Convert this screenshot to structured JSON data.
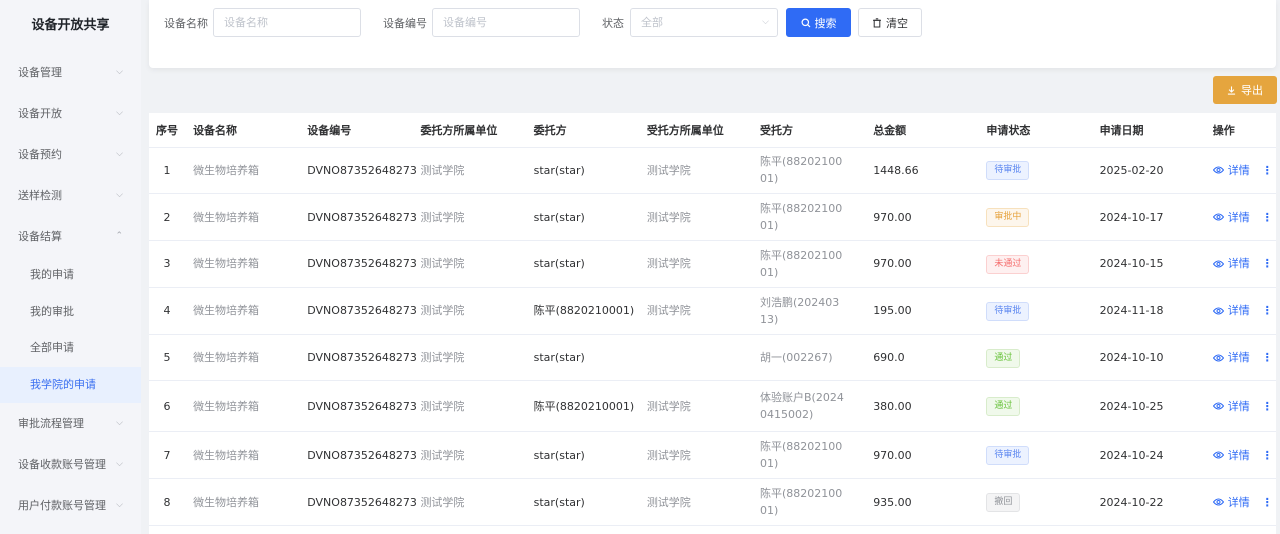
{
  "sidebar": {
    "title": "设备开放共享",
    "items": [
      {
        "label": "设备管理",
        "chevron": "⌵"
      },
      {
        "label": "设备开放",
        "chevron": "⌵"
      },
      {
        "label": "设备预约",
        "chevron": "⌵"
      },
      {
        "label": "送样检测",
        "chevron": "⌵"
      },
      {
        "label": "设备结算",
        "chevron": "⌃"
      }
    ],
    "subitems": [
      {
        "label": "我的申请"
      },
      {
        "label": "我的审批"
      },
      {
        "label": "全部申请"
      },
      {
        "label": "我学院的申请"
      }
    ],
    "items_after": [
      {
        "label": "审批流程管理",
        "chevron": "⌵"
      },
      {
        "label": "设备收款账号管理",
        "chevron": "⌵"
      },
      {
        "label": "用户付款账号管理",
        "chevron": "⌵"
      }
    ]
  },
  "search": {
    "device_name_label": "设备名称",
    "device_name_placeholder": "设备名称",
    "device_code_label": "设备编号",
    "device_code_placeholder": "设备编号",
    "status_label": "状态",
    "status_value": "全部",
    "search_button": "搜索",
    "clear_button": "清空"
  },
  "toolbar": {
    "export_button": "导出"
  },
  "table": {
    "columns": [
      "序号",
      "设备名称",
      "设备编号",
      "委托方所属单位",
      "委托方",
      "受托方所属单位",
      "受托方",
      "总金额",
      "申请状态",
      "申请日期",
      "操作"
    ],
    "detail_label": "详情",
    "rows": [
      {
        "no": "1",
        "device": "微生物培养箱",
        "code": "DVNO87352648273",
        "client_unit": "测试学院",
        "client": "star(star)",
        "trustee_unit": "测试学院",
        "trustee": "陈平(8820210001)",
        "amount": "1448.66",
        "status": "待审批",
        "status_color": "blue",
        "date": "2025-02-20"
      },
      {
        "no": "2",
        "device": "微生物培养箱",
        "code": "DVNO87352648273",
        "client_unit": "测试学院",
        "client": "star(star)",
        "trustee_unit": "测试学院",
        "trustee": "陈平(8820210001)",
        "amount": "970.00",
        "status": "审批中",
        "status_color": "orange",
        "date": "2024-10-17"
      },
      {
        "no": "3",
        "device": "微生物培养箱",
        "code": "DVNO87352648273",
        "client_unit": "测试学院",
        "client": "star(star)",
        "trustee_unit": "测试学院",
        "trustee": "陈平(8820210001)",
        "amount": "970.00",
        "status": "未通过",
        "status_color": "red",
        "date": "2024-10-15"
      },
      {
        "no": "4",
        "device": "微生物培养箱",
        "code": "DVNO87352648273",
        "client_unit": "测试学院",
        "client": "陈平(8820210001)",
        "trustee_unit": "测试学院",
        "trustee": "刘浩鹏(20240313)",
        "amount": "195.00",
        "status": "待审批",
        "status_color": "blue",
        "date": "2024-11-18"
      },
      {
        "no": "5",
        "device": "微生物培养箱",
        "code": "DVNO87352648273",
        "client_unit": "测试学院",
        "client": "star(star)",
        "trustee_unit": "",
        "trustee": "胡一(002267)",
        "amount": "690.0",
        "status": "通过",
        "status_color": "green",
        "date": "2024-10-10"
      },
      {
        "no": "6",
        "device": "微生物培养箱",
        "code": "DVNO87352648273",
        "client_unit": "测试学院",
        "client": "陈平(8820210001)",
        "trustee_unit": "测试学院",
        "trustee": "体验账户B(20240415002)",
        "amount": "380.00",
        "status": "通过",
        "status_color": "green",
        "date": "2024-10-25"
      },
      {
        "no": "7",
        "device": "微生物培养箱",
        "code": "DVNO87352648273",
        "client_unit": "测试学院",
        "client": "star(star)",
        "trustee_unit": "测试学院",
        "trustee": "陈平(8820210001)",
        "amount": "970.00",
        "status": "待审批",
        "status_color": "blue",
        "date": "2024-10-24"
      },
      {
        "no": "8",
        "device": "微生物培养箱",
        "code": "DVNO87352648273",
        "client_unit": "测试学院",
        "client": "star(star)",
        "trustee_unit": "测试学院",
        "trustee": "陈平(8820210001)",
        "amount": "935.00",
        "status": "撤回",
        "status_color": "gray",
        "date": "2024-10-22"
      }
    ]
  }
}
